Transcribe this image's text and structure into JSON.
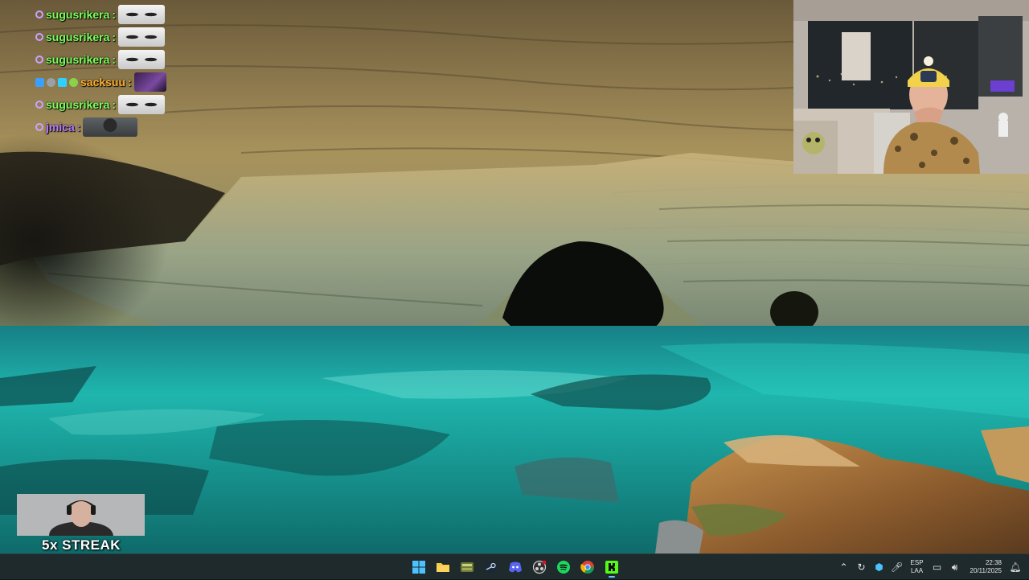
{
  "chat": {
    "messages": [
      {
        "user": "sugusrikera",
        "color": "green",
        "emote": "ghost-emote"
      },
      {
        "user": "sugusrikera",
        "color": "green",
        "emote": "ghost-emote"
      },
      {
        "user": "sugusrikera",
        "color": "green",
        "emote": "ghost-emote"
      },
      {
        "user": "sacksuu",
        "color": "orange",
        "emote": "dark-emote"
      },
      {
        "user": "sugusrikera",
        "color": "green",
        "emote": "ghost-emote"
      },
      {
        "user": "jmica",
        "color": "purple",
        "emote": "face-emote"
      }
    ],
    "separator": ":"
  },
  "overlay": {
    "streak_label": "5x STREAK"
  },
  "taskbar": {
    "apps": [
      {
        "name": "windows-start",
        "icon": "windows-logo-icon"
      },
      {
        "name": "file-explorer",
        "icon": "folder-icon"
      },
      {
        "name": "game-app",
        "icon": "game-tile-icon"
      },
      {
        "name": "steam",
        "icon": "steam-icon"
      },
      {
        "name": "discord",
        "icon": "discord-icon"
      },
      {
        "name": "obs-studio",
        "icon": "obs-icon"
      },
      {
        "name": "spotify",
        "icon": "spotify-icon"
      },
      {
        "name": "chrome",
        "icon": "chrome-icon"
      },
      {
        "name": "kick",
        "icon": "kick-icon"
      }
    ],
    "tray": {
      "language_line1": "ESP",
      "language_line2": "LAA",
      "time": "22:38",
      "date": "20/11/2025"
    }
  },
  "colors": {
    "chat_green": "#7cff5c",
    "chat_orange": "#ffb02e",
    "chat_purple": "#b57cff",
    "taskbar_bg": "#1f2a2c",
    "water_turquoise": "#1fc8bf"
  }
}
